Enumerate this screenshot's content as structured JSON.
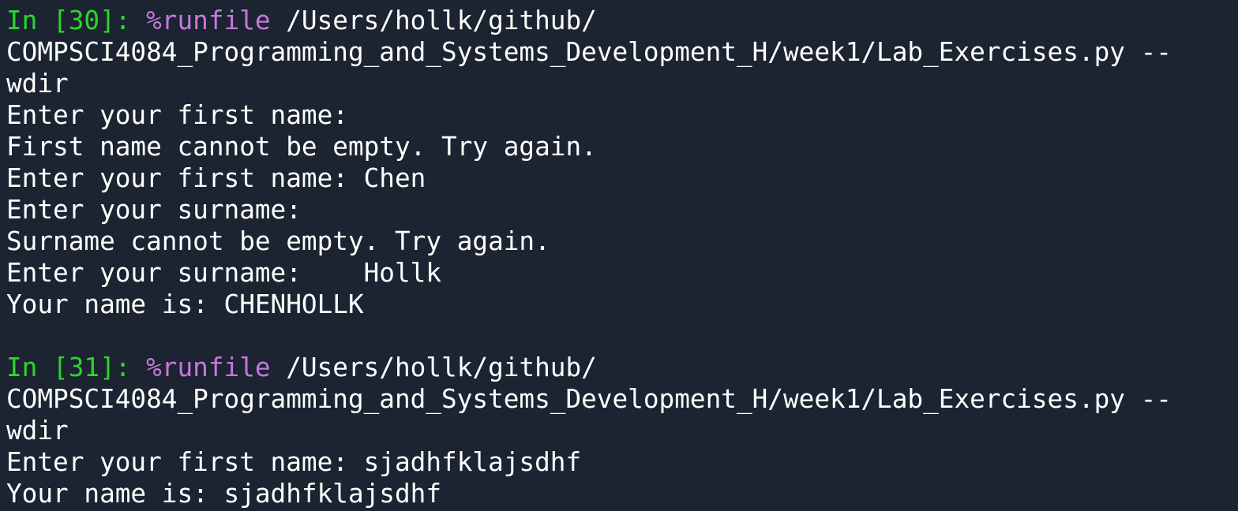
{
  "console": {
    "cell1": {
      "prompt": "In [30]:",
      "magic": "%runfile",
      "args": "/Users/hollk/github/",
      "cont1": "COMPSCI4084_Programming_and_Systems_Development_H/week1/Lab_Exercises.py --",
      "cont2": "wdir",
      "output": [
        "Enter your first name:",
        "First name cannot be empty. Try again.",
        "Enter your first name: Chen",
        "Enter your surname:",
        "Surname cannot be empty. Try again.",
        "Enter your surname:    Hollk",
        "Your name is: CHENHOLLK"
      ]
    },
    "cell2": {
      "prompt": "In [31]:",
      "magic": "%runfile",
      "args": "/Users/hollk/github/",
      "cont1": "COMPSCI4084_Programming_and_Systems_Development_H/week1/Lab_Exercises.py --",
      "cont2": "wdir",
      "output": [
        "Enter your first name: sjadhfklajsdhf",
        "Your name is: sjadhfklajsdhf"
      ]
    }
  }
}
